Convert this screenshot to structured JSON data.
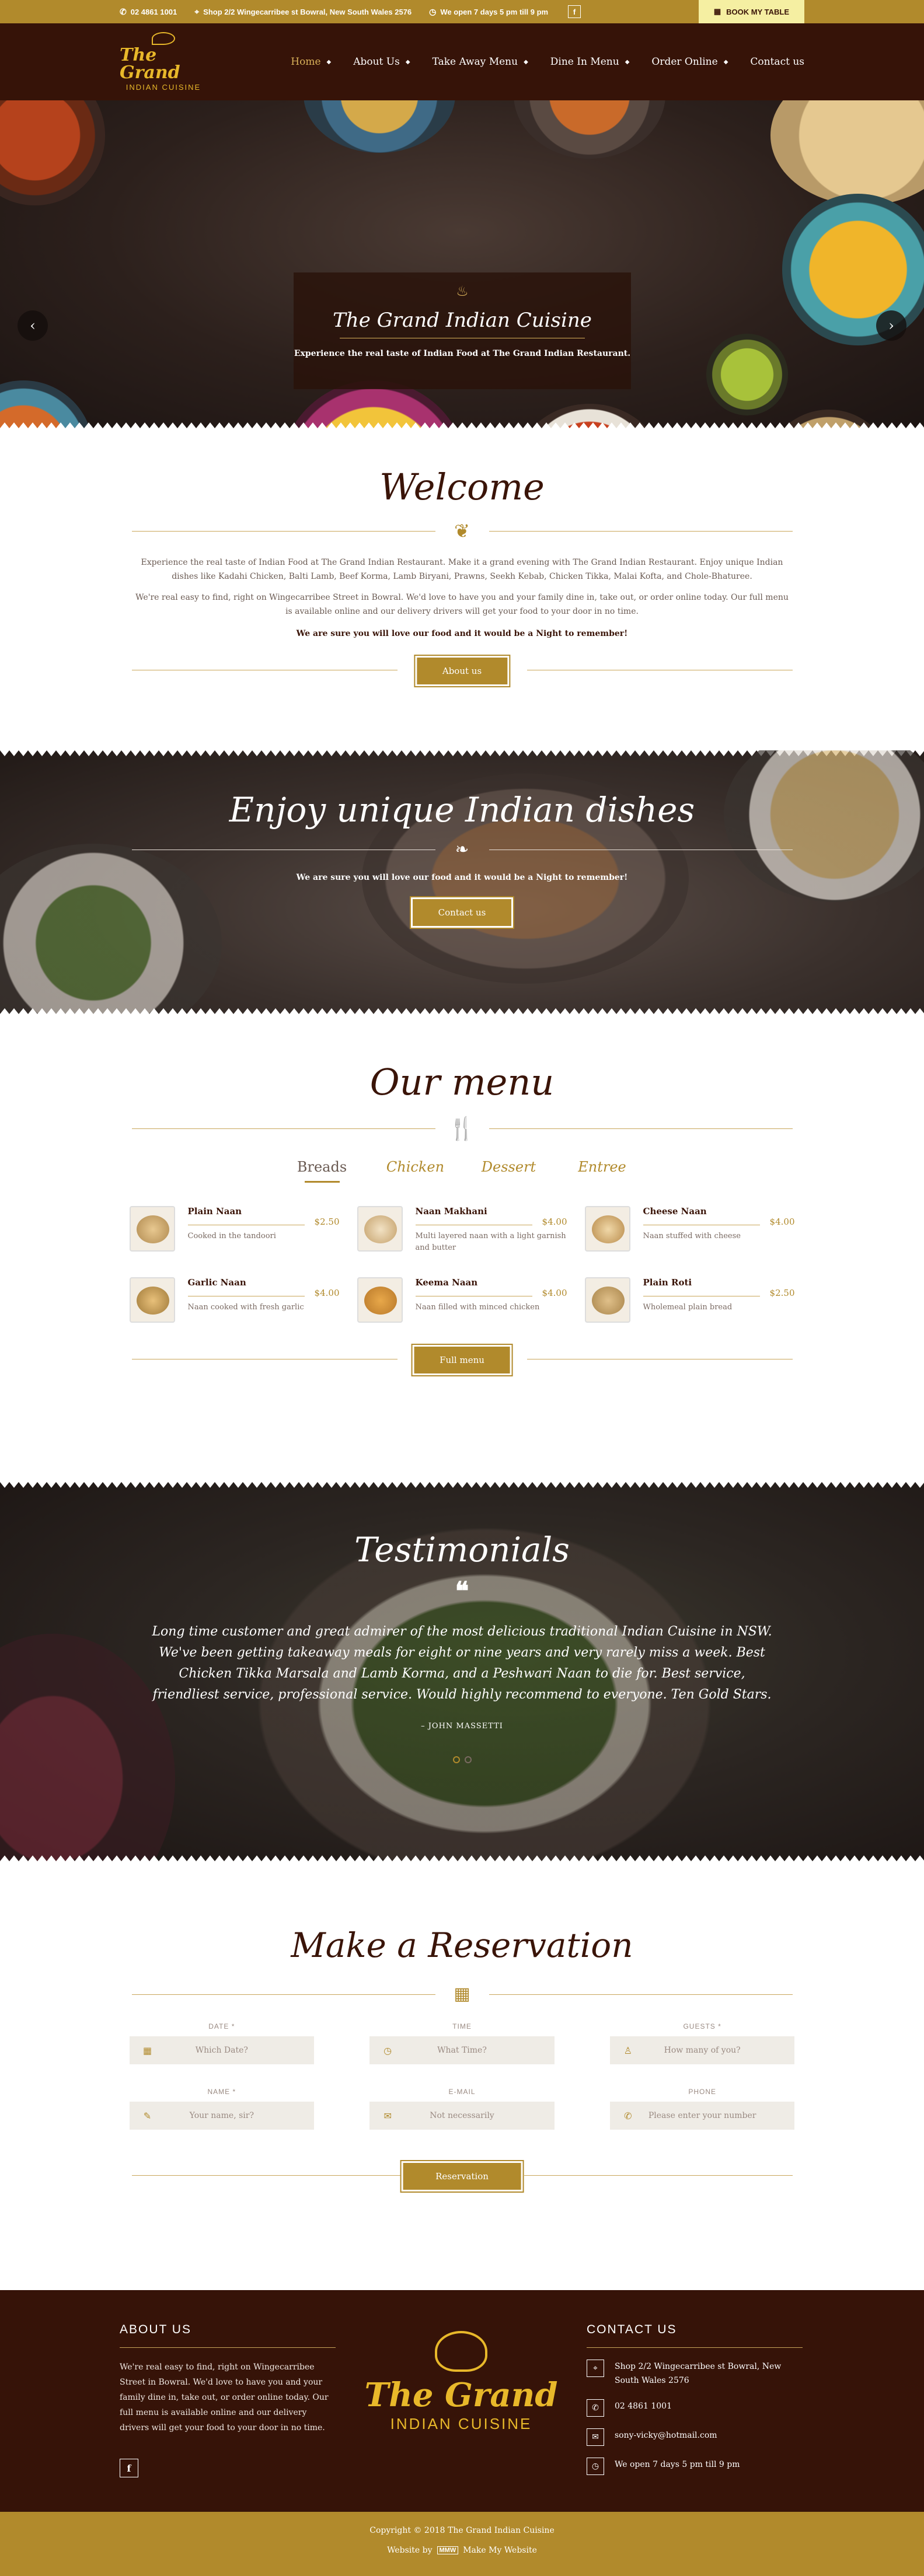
{
  "topbar": {
    "phone": "02 4861 1001",
    "address": "Shop 2/2 Wingecarribee st Bowral, New South Wales 2576",
    "hours": "We open 7 days 5 pm till 9 pm",
    "facebook": "f",
    "book_label": "BOOK MY TABLE"
  },
  "logo": {
    "line1": "The Grand",
    "line2": "INDIAN CUISINE"
  },
  "nav": {
    "items": [
      {
        "label": "Home"
      },
      {
        "label": "About Us"
      },
      {
        "label": "Take Away Menu"
      },
      {
        "label": "Dine In Menu"
      },
      {
        "label": "Order Online"
      },
      {
        "label": "Contact us"
      }
    ]
  },
  "hero": {
    "title": "The Grand Indian Cuisine",
    "subtitle": "Experience the real taste of Indian Food at The Grand Indian Restaurant.",
    "prev": "‹",
    "next": "›"
  },
  "welcome": {
    "title": "Welcome",
    "p1": "Experience the real taste of Indian Food at The Grand Indian Restaurant. Make it a grand evening with The Grand Indian Restaurant. Enjoy unique Indian dishes like Kadahi Chicken, Balti Lamb, Beef Korma, Lamb Biryani, Prawns, Seekh Kebab, Chicken Tikka, Malai Kofta, and Chole-Bhaturee.",
    "p2": "We're real easy to find, right on Wingecarribee Street in Bowral. We'd love to have you and your family dine in, take out, or order online today. Our full menu is available online and our delivery drivers will get your food to your door in no time.",
    "p3": "We are sure you will love our food and it would be a Night to remember!",
    "button": "About us"
  },
  "dishes_banner": {
    "title": "Enjoy unique Indian dishes",
    "text": "We are sure you will love our food and it would be a Night to remember!",
    "button": "Contact us"
  },
  "menu": {
    "title": "Our menu",
    "tabs": [
      {
        "label": "Breads"
      },
      {
        "label": "Chicken"
      },
      {
        "label": "Dessert"
      },
      {
        "label": "Entree"
      }
    ],
    "items": [
      {
        "name": "Plain Naan",
        "price": "$2.50",
        "desc": "Cooked in the tandoori"
      },
      {
        "name": "Naan Makhani",
        "price": "$4.00",
        "desc": "Multi layered naan with a light garnish and butter"
      },
      {
        "name": "Cheese Naan",
        "price": "$4.00",
        "desc": "Naan stuffed with cheese"
      },
      {
        "name": "Garlic Naan",
        "price": "$4.00",
        "desc": "Naan cooked with fresh garlic"
      },
      {
        "name": "Keema Naan",
        "price": "$4.00",
        "desc": "Naan filled with minced chicken"
      },
      {
        "name": "Plain Roti",
        "price": "$2.50",
        "desc": "Wholemeal plain bread"
      }
    ],
    "button": "Full menu"
  },
  "testimonials": {
    "title": "Testimonials",
    "quote": "Long time customer and great admirer of the most delicious traditional Indian Cuisine in NSW. We've been getting takeaway meals for eight or nine years and very rarely miss a week. Best Chicken Tikka Marsala and Lamb Korma, and a Peshwari Naan to die for. Best service, friendliest service, professional service. Would highly recommend to everyone. Ten Gold Stars.",
    "author": "– JOHN MASSETTI"
  },
  "reservation": {
    "title": "Make a Reservation",
    "fields": [
      {
        "label": "DATE *",
        "placeholder": "Which Date?",
        "icon": "calendar-icon"
      },
      {
        "label": "TIME",
        "placeholder": "What Time?",
        "icon": "clock-icon"
      },
      {
        "label": "GUESTS *",
        "placeholder": "How many of you?",
        "icon": "user-icon"
      },
      {
        "label": "NAME *",
        "placeholder": "Your name, sir?",
        "icon": "pencil-icon"
      },
      {
        "label": "E-MAIL",
        "placeholder": "Not necessarily",
        "icon": "envelope-icon"
      },
      {
        "label": "PHONE",
        "placeholder": "Please enter your number",
        "icon": "phone-icon"
      }
    ],
    "button": "Reservation"
  },
  "footer": {
    "about_title": "ABOUT US",
    "about_text": "We're real easy to find, right on Wingecarribee Street in Bowral. We'd love to have you and your family dine in, take out, or order online today. Our full menu is available online and our delivery drivers will get your food to your door in no time.",
    "facebook": "f",
    "logo_line1": "The Grand",
    "logo_line2": "INDIAN CUISINE",
    "contact_title": "CONTACT US",
    "address": "Shop 2/2 Wingecarribee st Bowral, New South Wales 2576",
    "phone": "02 4861 1001",
    "email": "sony-vicky@hotmail.com",
    "hours": "We open 7 days 5 pm till 9 pm"
  },
  "bottom": {
    "copyright": "Copyright © 2018 The Grand Indian Cuisine",
    "credit_prefix": "Website by",
    "credit_badge": "MMW",
    "credit_name": "Make My Website"
  },
  "colors": {
    "gold": "#b18a2c",
    "maroon": "#361308",
    "cream_button": "#f5efa2"
  }
}
